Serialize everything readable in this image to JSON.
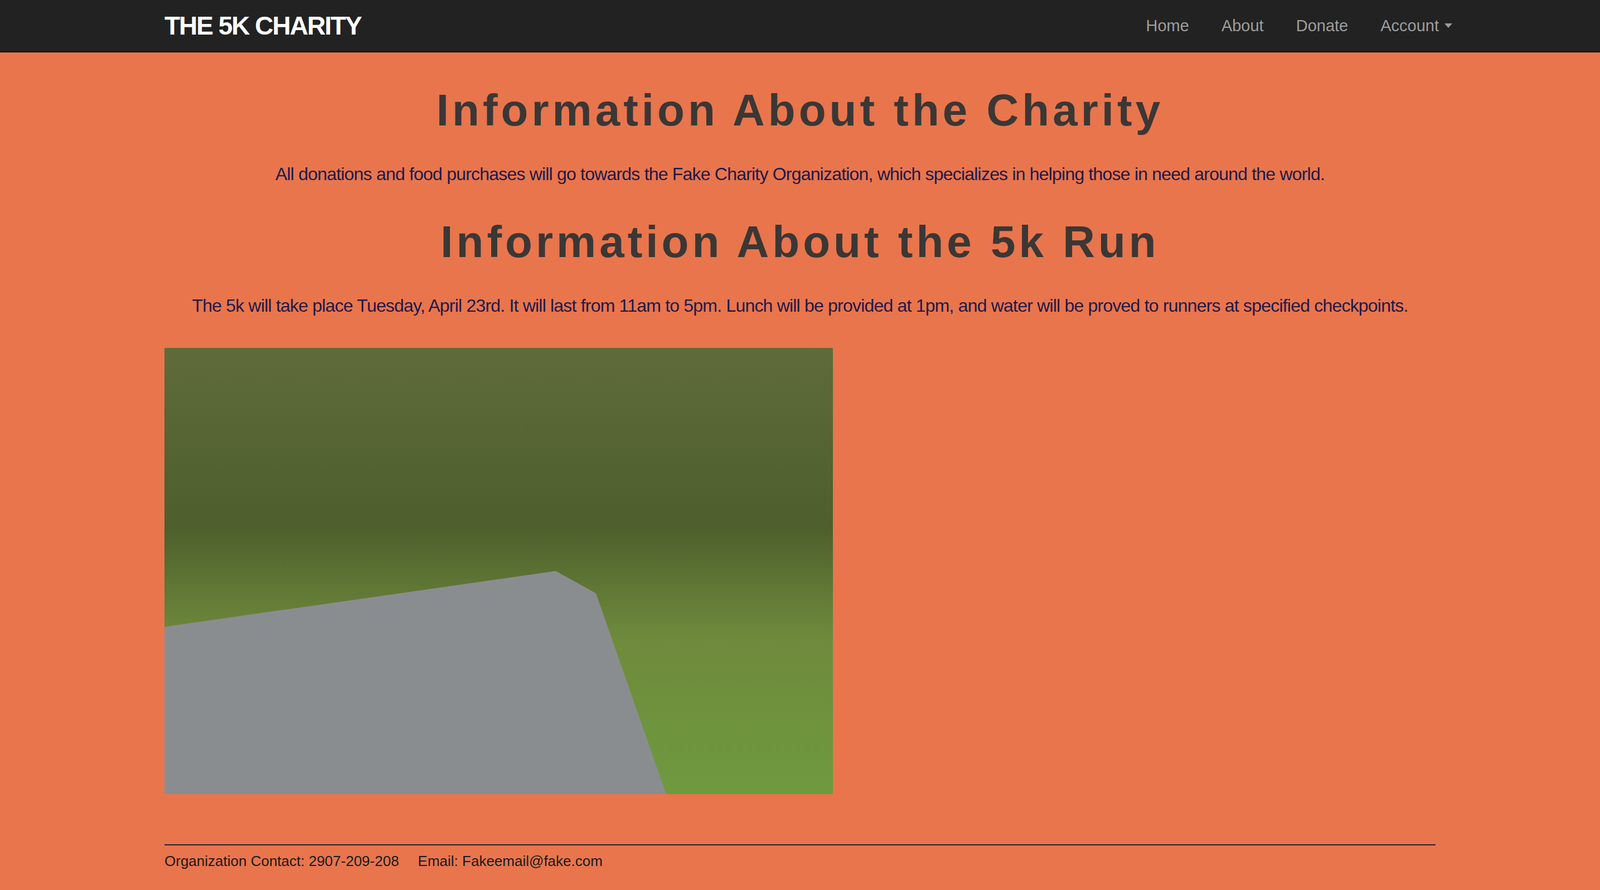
{
  "navbar": {
    "brand": "THE 5K CHARITY",
    "links": [
      {
        "label": "Home",
        "dropdown": false
      },
      {
        "label": "About",
        "dropdown": false
      },
      {
        "label": "Donate",
        "dropdown": false
      },
      {
        "label": "Account",
        "dropdown": true
      }
    ]
  },
  "sections": [
    {
      "heading": "Information About the Charity",
      "text": "All donations and food purchases will go towards the Fake Charity Organization, which specializes in helping those in need around the world."
    },
    {
      "heading": "Information About the 5k Run",
      "text": "The 5k will take place Tuesday, April 23rd. It will last from 11am to 5pm. Lunch will be provided at 1pm, and water will be proved to runners at specified checkpoints."
    }
  ],
  "footer": {
    "contact": "Organization Contact: 2907-209-208",
    "email": "Email: Fakeemail@fake.com"
  }
}
